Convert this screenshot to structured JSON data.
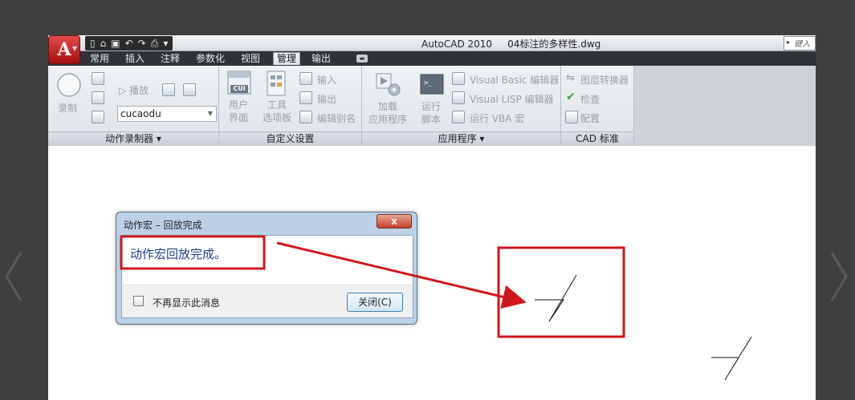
{
  "app": {
    "logo_letter": "A",
    "title": "AutoCAD 2010     04标注的多样性.dwg",
    "search_placeholder": "键入"
  },
  "quick_access": {
    "icons": [
      "new-icon",
      "open-icon",
      "save-icon",
      "undo-icon",
      "redo-icon",
      "plot-icon",
      "customize-qat-icon"
    ],
    "glyphs": [
      "▯",
      "⌂",
      "▣",
      "↶",
      "↷",
      "⎙",
      "▾"
    ]
  },
  "tabs": [
    {
      "label": "常用",
      "active": false
    },
    {
      "label": "插入",
      "active": false
    },
    {
      "label": "注释",
      "active": false
    },
    {
      "label": "参数化",
      "active": false
    },
    {
      "label": "视图",
      "active": false
    },
    {
      "label": "管理",
      "active": true
    },
    {
      "label": "输出",
      "active": false
    }
  ],
  "panels": {
    "action_recorder": {
      "title": "动作录制器 ▾",
      "record_label": "录制",
      "play_label": "▷ 播放",
      "macro_name": "cucaodu"
    },
    "customization": {
      "title": "自定义设置",
      "cui_badge": "CUI",
      "user_interface_label_1": "用户",
      "user_interface_label_2": "界面",
      "tool_palettes_label_1": "工具",
      "tool_palettes_label_2": "选项板",
      "import_label": "输入",
      "export_label": "输出",
      "edit_aliases_label": "编辑别名"
    },
    "applications": {
      "title": "应用程序 ▾",
      "load_app_label_1": "加载",
      "load_app_label_2": "应用程序",
      "run_script_label_1": "运行",
      "run_script_label_2": "脚本",
      "vba_editor_label": "Visual Basic 编辑器",
      "lisp_editor_label": "Visual LISP 编辑器",
      "run_vba_label": "运行 VBA 宏"
    },
    "cad_standards": {
      "title": "CAD 标准",
      "layer_translator_label": "图层转换器",
      "check_label": "检查",
      "configure_label": "配置"
    }
  },
  "dialog": {
    "title": "动作宏 – 回放完成",
    "message": "动作宏回放完成。",
    "checkbox_label": "不再显示此消息",
    "close_button": "关闭(C)",
    "close_x": "x"
  },
  "colors": {
    "annotation_red": "#d0161c",
    "ribbon_bg": "#e6eaee",
    "tabbar_bg": "#2f3237",
    "dialog_frame": "#bcd0e6"
  }
}
